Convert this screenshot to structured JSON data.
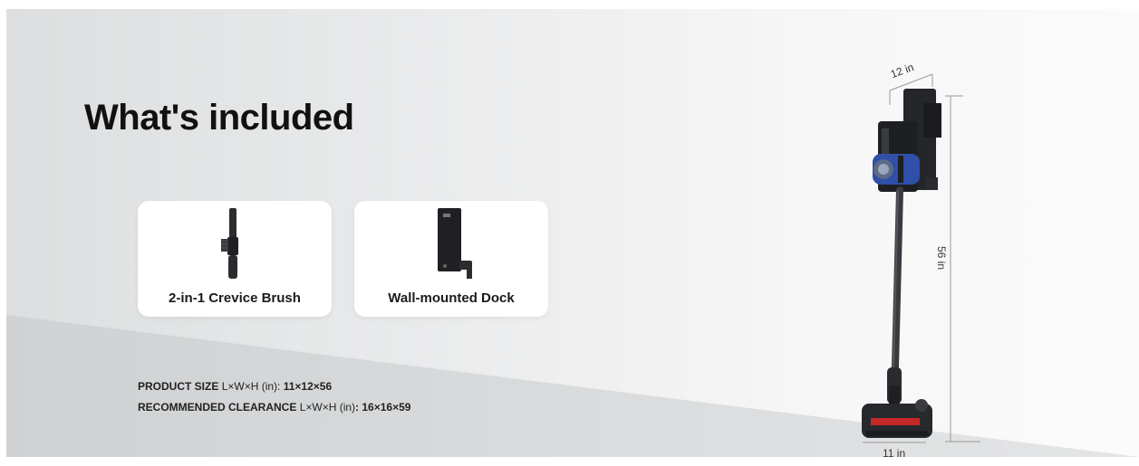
{
  "heading": "What's included",
  "items": [
    {
      "label": "2-in-1 Crevice Brush"
    },
    {
      "label": "Wall-mounted Dock"
    }
  ],
  "specs": {
    "product_size": {
      "label": "PRODUCT SIZE",
      "unit": "L×W×H (in):",
      "value": "11×12×56"
    },
    "clearance": {
      "label": "RECOMMENDED CLEARANCE",
      "unit": "L×W×H (in)",
      "value": ": 16×16×59"
    }
  },
  "dimensions": {
    "width": "12 in",
    "height": "56 in",
    "length": "11 in"
  },
  "colors": {
    "accent_blue": "#2f4fa8",
    "accent_red": "#c62828",
    "dark": "#1e1f22"
  }
}
